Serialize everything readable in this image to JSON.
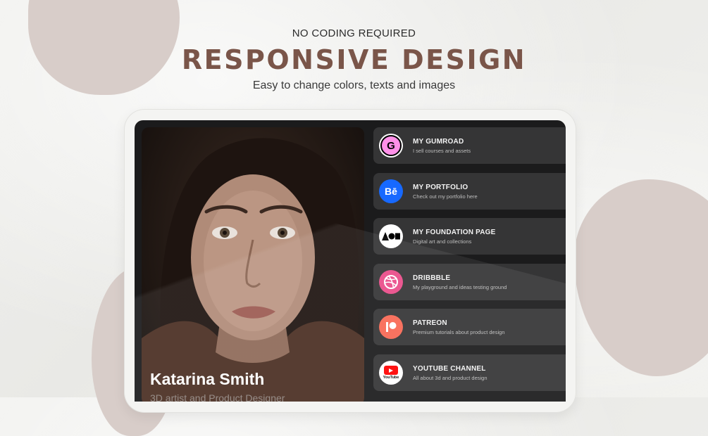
{
  "header": {
    "eyebrow": "NO CODING REQUIRED",
    "headline": "RESPONSIVE DESIGN",
    "subline": "Easy to change colors, texts and images"
  },
  "profile": {
    "name": "Katarina Smith",
    "role": "3D artist and Product Designer"
  },
  "links": [
    {
      "title": "MY GUMROAD",
      "subtitle": "I sell courses and assets",
      "icon": "gumroad-icon",
      "color": "#ff90e8"
    },
    {
      "title": "MY PORTFOLIO",
      "subtitle": "Check out my portfolio here",
      "icon": "behance-icon",
      "color": "#1769ff"
    },
    {
      "title": "MY FOUNDATION PAGE",
      "subtitle": "Digital art and collections",
      "icon": "foundation-icon",
      "color": "#ffffff"
    },
    {
      "title": "DRIBBBLE",
      "subtitle": "My playground and ideas testing ground",
      "icon": "dribbble-icon",
      "color": "#ea4c89"
    },
    {
      "title": "PATREON",
      "subtitle": "Premium tutorials about product design",
      "icon": "patreon-icon",
      "color": "#f96854"
    },
    {
      "title": "YOUTUBE CHANNEL",
      "subtitle": "All about 3d and product design",
      "icon": "youtube-icon",
      "color": "#ff0000"
    }
  ],
  "icon_glyphs": {
    "gumroad": "G",
    "behance": "Bē",
    "youtube": "YouTube"
  },
  "colors": {
    "headline": "#7a5549",
    "blob": "#d8cdc9",
    "card": "#353536",
    "screen": "#1b1b1c"
  }
}
